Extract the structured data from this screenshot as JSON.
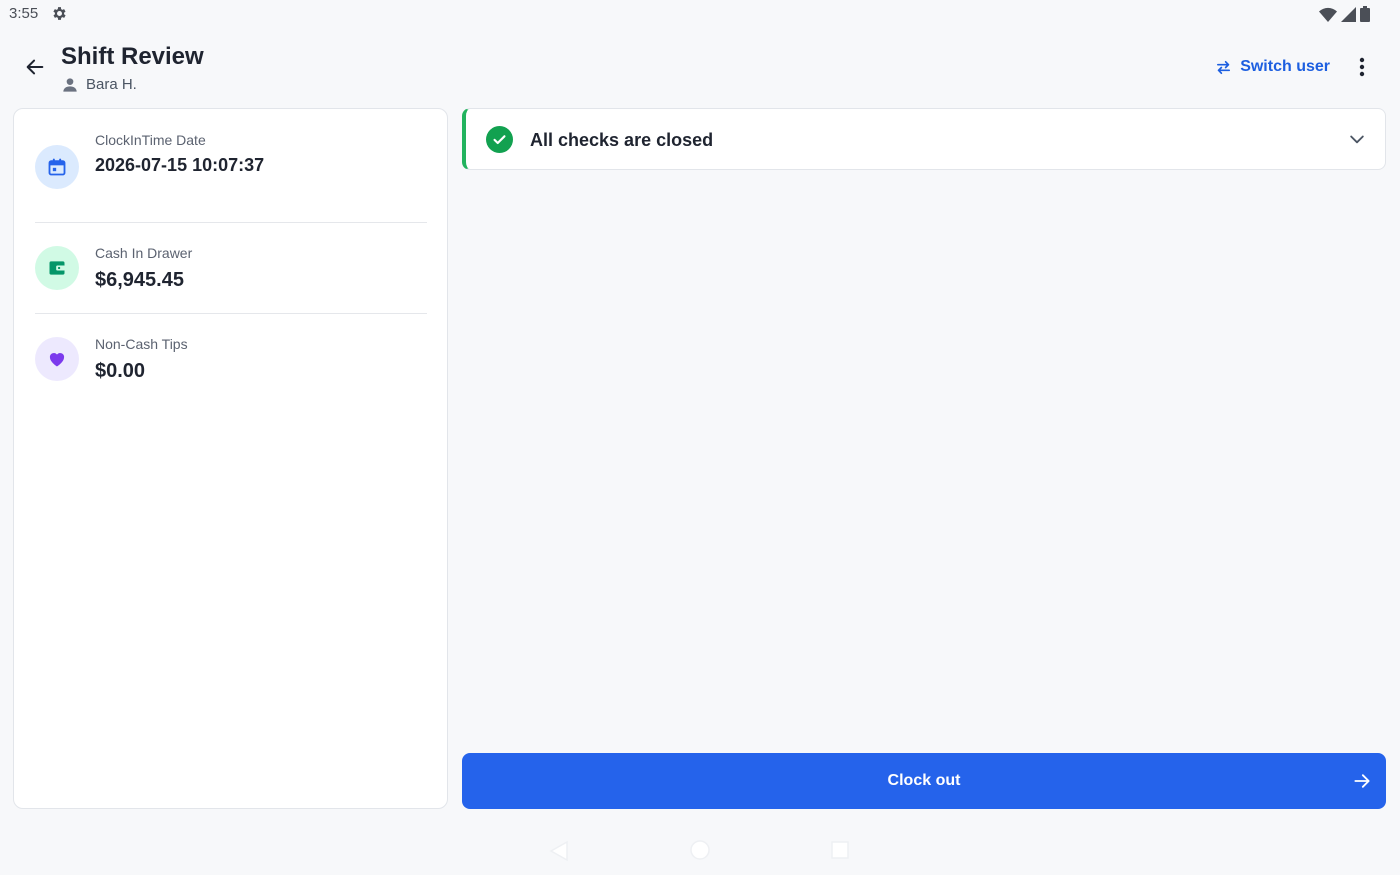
{
  "status_bar": {
    "time": "3:55",
    "icons": [
      "gear-icon",
      "wifi-icon",
      "signal-icon",
      "battery-icon"
    ]
  },
  "header": {
    "title": "Shift Review",
    "user_name": "Bara H.",
    "switch_user_label": "Switch user"
  },
  "stats": [
    {
      "label": "ClockInTime Date",
      "value": "2026-07-15 10:07:37",
      "icon": "calendar-icon",
      "icon_color": "#2563eb",
      "icon_bg": "#dbeafe"
    },
    {
      "label": "Cash In Drawer",
      "value": "$6,945.45",
      "icon": "wallet-icon",
      "icon_color": "#059669",
      "icon_bg": "#d1fae5"
    },
    {
      "label": "Non-Cash Tips",
      "value": "$0.00",
      "icon": "heart-icon",
      "icon_color": "#7c3aed",
      "icon_bg": "#ede9fe"
    }
  ],
  "checks": {
    "title": "All checks are closed",
    "status_color": "#12a150"
  },
  "clock_out": {
    "label": "Clock out",
    "color": "#2563eb"
  },
  "colors": {
    "accent": "#1d5fe0",
    "background": "#f7f8fa"
  }
}
